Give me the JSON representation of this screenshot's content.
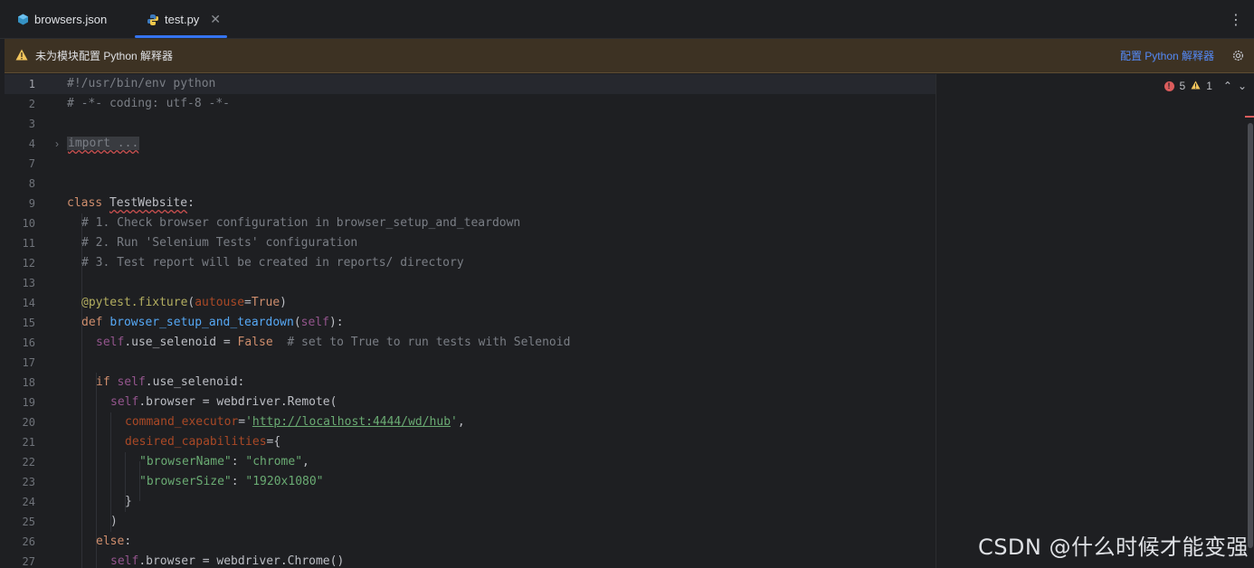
{
  "tabs": [
    {
      "label": "browsers.json",
      "icon": "json-cube-icon",
      "active": false
    },
    {
      "label": "test.py",
      "icon": "python-icon",
      "active": true
    }
  ],
  "banner": {
    "message": "未为模块配置 Python 解释器",
    "action": "配置 Python 解释器"
  },
  "inspections": {
    "errors": "5",
    "warnings": "1"
  },
  "line_numbers": [
    "1",
    "2",
    "3",
    "4",
    "7",
    "8",
    "9",
    "10",
    "11",
    "12",
    "13",
    "14",
    "15",
    "16",
    "17",
    "18",
    "19",
    "20",
    "21",
    "22",
    "23",
    "24",
    "25",
    "26",
    "27"
  ],
  "code": {
    "l1": "#!/usr/bin/env python",
    "l2": "# -*- coding: utf-8 -*-",
    "l4": "import ...",
    "l9_kw": "class",
    "l9_name": "TestWebsite",
    "l9_end": ":",
    "l10": "# 1. Check browser configuration in browser_setup_and_teardown",
    "l11": "# 2. Run 'Selenium Tests' configuration",
    "l12": "# 3. Test report will be created in reports/ directory",
    "l14_dec": "@pytest.fixture",
    "l14_open": "(",
    "l14_param": "autouse",
    "l14_eq": "=",
    "l14_val": "True",
    "l14_close": ")",
    "l15_kw": "def",
    "l15_fn": "browser_setup_and_teardown",
    "l15_open": "(",
    "l15_self": "self",
    "l15_close": "):",
    "l16_self": "self",
    "l16_mid": ".use_selenoid = ",
    "l16_val": "False",
    "l16_cm": "  # set to True to run tests with Selenoid",
    "l18_kw": "if",
    "l18_self": "self",
    "l18_rest": ".use_selenoid:",
    "l19_self": "self",
    "l19_rest": ".browser = webdriver.Remote(",
    "l20_param": "command_executor",
    "l20_eq": "=",
    "l20_q1": "'",
    "l20_url": "http://localhost:4444/wd/hub",
    "l20_q2": "'",
    "l20_end": ",",
    "l21_param": "desired_capabilities",
    "l21_rest": "={",
    "l22_key": "\"browserName\"",
    "l22_colon": ": ",
    "l22_val": "\"chrome\"",
    "l22_end": ",",
    "l23_key": "\"browserSize\"",
    "l23_colon": ": ",
    "l23_val": "\"1920x1080\"",
    "l24": "}",
    "l25": ")",
    "l26_kw": "else",
    "l26_end": ":",
    "l27_self": "self",
    "l27_rest": ".browser = webdriver.Chrome()"
  },
  "watermark": "CSDN @什么时候才能变强"
}
